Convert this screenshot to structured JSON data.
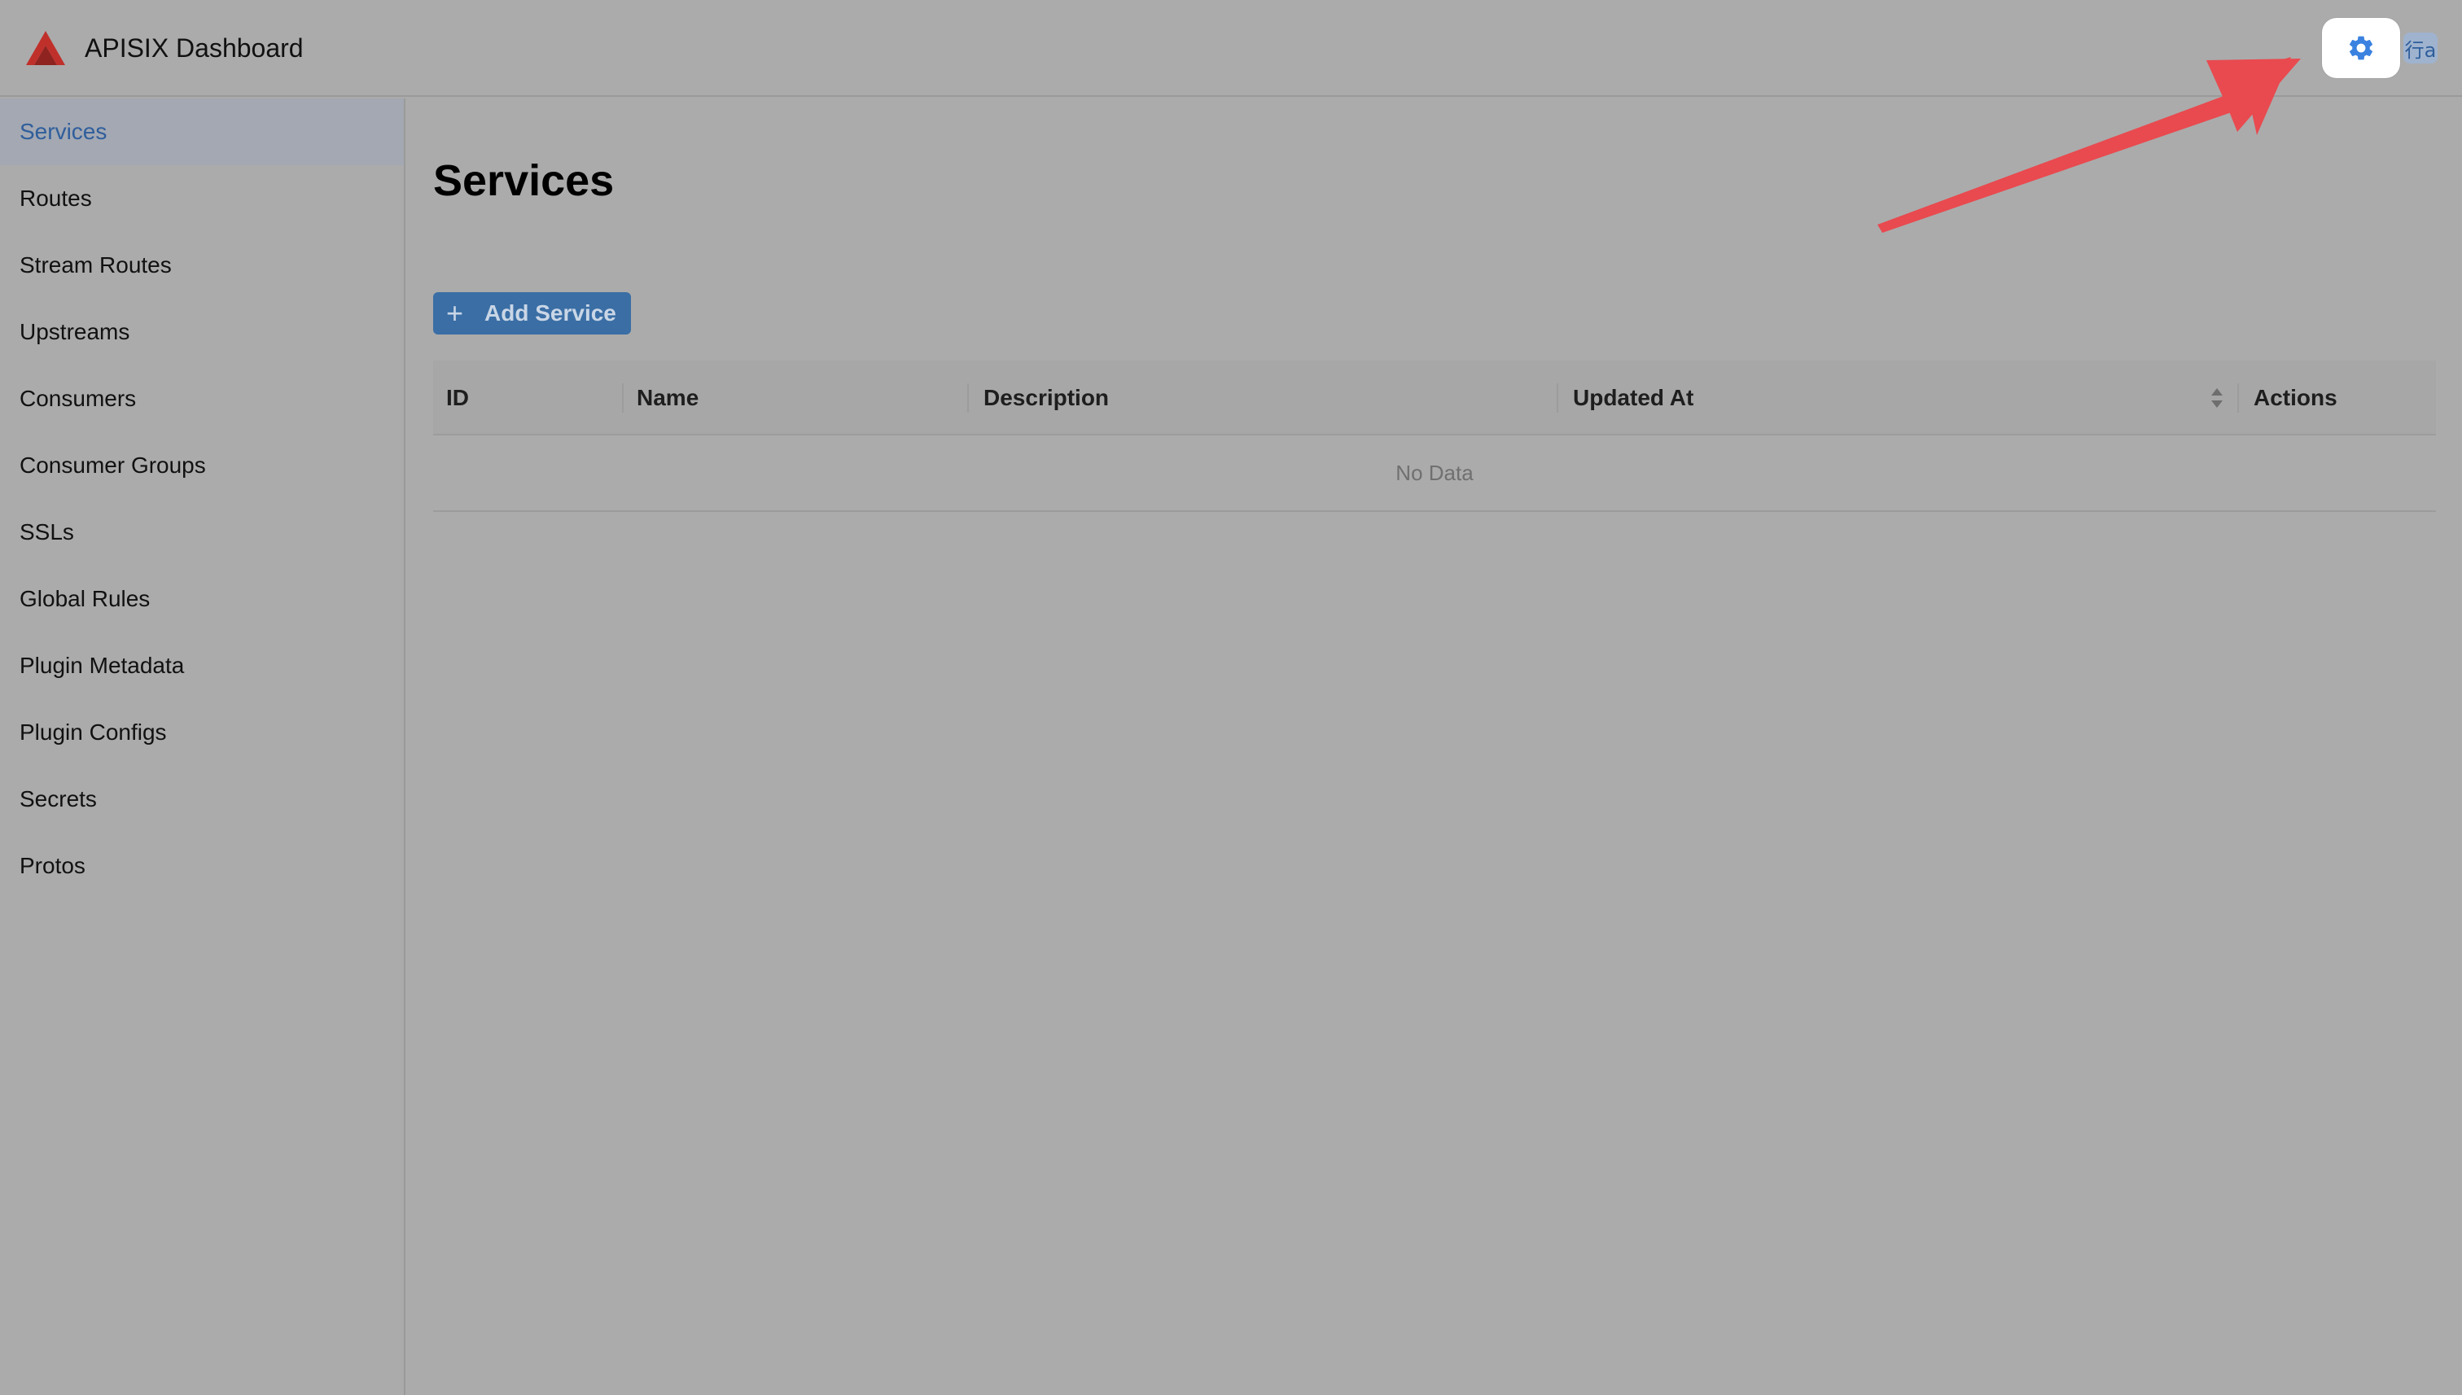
{
  "header": {
    "app_title": "APISIX Dashboard",
    "lang_label": "行a",
    "settings_icon": "gear-icon",
    "logo_icon": "apisix-logo-icon"
  },
  "sidebar": {
    "items": [
      {
        "label": "Services",
        "active": true
      },
      {
        "label": "Routes",
        "active": false
      },
      {
        "label": "Stream Routes",
        "active": false
      },
      {
        "label": "Upstreams",
        "active": false
      },
      {
        "label": "Consumers",
        "active": false
      },
      {
        "label": "Consumer Groups",
        "active": false
      },
      {
        "label": "SSLs",
        "active": false
      },
      {
        "label": "Global Rules",
        "active": false
      },
      {
        "label": "Plugin Metadata",
        "active": false
      },
      {
        "label": "Plugin Configs",
        "active": false
      },
      {
        "label": "Secrets",
        "active": false
      },
      {
        "label": "Protos",
        "active": false
      }
    ]
  },
  "main": {
    "page_title": "Services",
    "add_button_label": "Add Service",
    "table": {
      "columns": [
        "ID",
        "Name",
        "Description",
        "Updated At",
        "Actions"
      ],
      "empty_text": "No Data"
    }
  },
  "colors": {
    "accent": "#3a6ea5",
    "annotation_arrow": "#e84a4f",
    "settings_icon": "#3b82e0"
  }
}
